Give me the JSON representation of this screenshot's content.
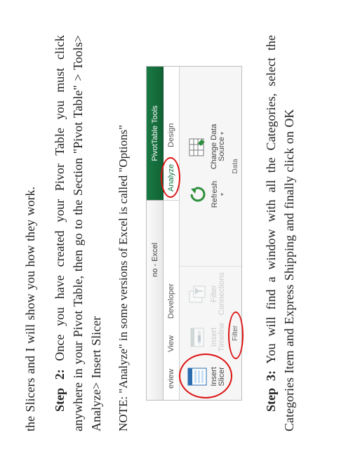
{
  "body": {
    "intro_fragment": "the Slicers and I will show you how they work.",
    "step2_label": "Step 2:",
    "step2_text_a": " Once you have created your Pivor Table you must click anywhere in your Pivot Table, then go to the Section \"Pivot Table\" > Tools> Analyze> Insert Slicer",
    "note": "NOTE: \"Analyze\" in some versions of Excel is called \"Options\"",
    "step3_label": "Step 3:",
    "step3_text": " You will find a window with all the Categories, select the Categories Item and Express Shipping and finally click on OK"
  },
  "ribbon": {
    "title_left": "no - Excel",
    "title_right": "PivotTable Tools",
    "tabs_left": [
      "eview",
      "View",
      "Developer"
    ],
    "tabs_right": [
      "Analyze",
      "Design"
    ],
    "filter_group_label": "Filter",
    "data_group_label": "Data",
    "buttons": {
      "insert_slicer_l1": "Insert",
      "insert_slicer_l2": "Slicer",
      "insert_timeline_l1": "Insert",
      "insert_timeline_l2": "Timeline",
      "filter_connections_l1": "Filter",
      "filter_connections_l2": "Connections",
      "refresh": "Refresh",
      "change_data_l1": "Change Data",
      "change_data_l2": "Source"
    }
  }
}
